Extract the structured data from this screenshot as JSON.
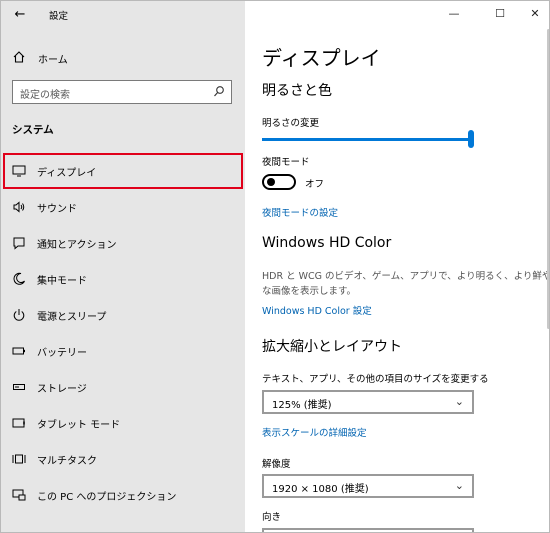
{
  "app": {
    "title": "設定"
  },
  "window_controls": {
    "minimize": "—",
    "maximize": "☐",
    "close": "✕"
  },
  "sidebar": {
    "home_label": "ホーム",
    "search_placeholder": "設定の検索",
    "section_title": "システム",
    "items": [
      {
        "label": "ディスプレイ",
        "icon": "monitor-icon",
        "selected": true
      },
      {
        "label": "サウンド",
        "icon": "speaker-icon",
        "selected": false
      },
      {
        "label": "通知とアクション",
        "icon": "notification-icon",
        "selected": false
      },
      {
        "label": "集中モード",
        "icon": "moon-icon",
        "selected": false
      },
      {
        "label": "電源とスリープ",
        "icon": "power-icon",
        "selected": false
      },
      {
        "label": "バッテリー",
        "icon": "battery-icon",
        "selected": false
      },
      {
        "label": "ストレージ",
        "icon": "storage-icon",
        "selected": false
      },
      {
        "label": "タブレット モード",
        "icon": "tablet-icon",
        "selected": false
      },
      {
        "label": "マルチタスク",
        "icon": "multitask-icon",
        "selected": false
      },
      {
        "label": "この PC へのプロジェクション",
        "icon": "projection-icon",
        "selected": false
      }
    ]
  },
  "main": {
    "title": "ディスプレイ",
    "brightness_section": "明るさと色",
    "brightness_label": "明るさの変更",
    "brightness_value": 1.0,
    "night_mode_label": "夜間モード",
    "night_mode_state": "オフ",
    "night_mode_link": "夜間モードの設定",
    "hdr_title": "Windows HD Color",
    "hdr_desc_line1": "HDR と WCG のビデオ、ゲーム、アプリで、より明るく、より鮮やか",
    "hdr_desc_line2": "な画像を表示します。",
    "hdr_link": "Windows HD Color 設定",
    "scale_section": "拡大縮小とレイアウト",
    "scale_label": "テキスト、アプリ、その他の項目のサイズを変更する",
    "scale_value": "125% (推奨)",
    "scale_link": "表示スケールの詳細設定",
    "resolution_label": "解像度",
    "resolution_value": "1920 × 1080 (推奨)",
    "orientation_label": "向き"
  },
  "colors": {
    "accent": "#0078d7",
    "link": "#0063b1",
    "selection_outline": "#e0001a",
    "sidebar_bg": "#e6e6e6"
  }
}
